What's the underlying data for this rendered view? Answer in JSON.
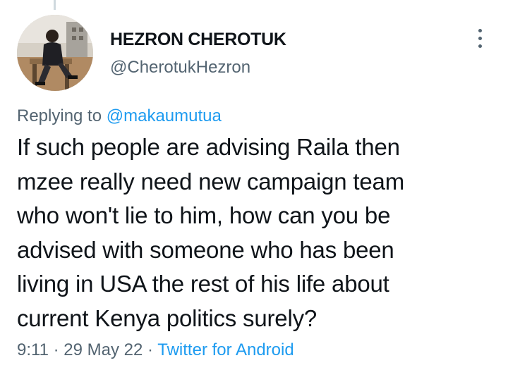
{
  "author": {
    "display_name": "HEZRON CHEROTUK",
    "handle": "@CherotukHezron"
  },
  "reply_context": {
    "prefix": "Replying to",
    "mention": "@makaumutua"
  },
  "tweet": {
    "lines": [
      "If such people are advising Raila then",
      "mzee really need new campaign team",
      "who won't lie to him, how can you be",
      "advised with someone who has been",
      "living in USA the rest of his life about",
      "current Kenya politics surely?"
    ]
  },
  "meta": {
    "time": "9:11",
    "separator": "·",
    "date": "29 May 22",
    "source": "Twitter for Android"
  },
  "icons": {
    "more": "more-vertical-icon"
  },
  "colors": {
    "text_primary": "#0f1419",
    "text_secondary": "#536471",
    "link": "#1d9bf0",
    "thread_line": "#cfd9de"
  }
}
